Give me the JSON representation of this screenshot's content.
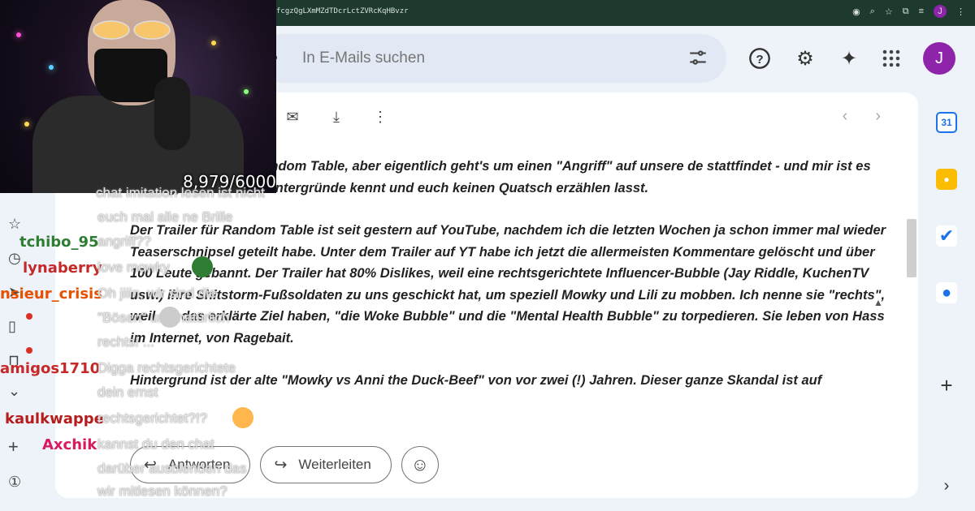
{
  "browser": {
    "url_fragment": "fcgzQgLXmMZdTDcrLctZVRcKqHBvzr",
    "profile_initial": "J"
  },
  "header": {
    "search_placeholder": "In E-Mails suchen",
    "account_initial": "J",
    "accent": "#8e24aa"
  },
  "toolbar": {
    "icons": [
      "mark-unread-icon",
      "move-to-inbox-icon",
      "more-vert-icon"
    ],
    "pager_icons": [
      "chevron-left-icon",
      "chevron-right-icon"
    ]
  },
  "mail": {
    "paragraphs": [
      "g um unseren Film Random Table, aber eigentlich geht's um einen \"Angriff\" auf unsere de stattfindet - und mir ist es wichtig, dass ihr die Hintergründe kennt und euch keinen Quatsch erzählen lasst.",
      "Der Trailer für Random Table ist seit gestern auf YouTube, nachdem ich die letzten Wochen ja schon immer mal wieder Teaserschnipsel geteilt habe. Unter dem Trailer auf YT habe ich jetzt die allermeisten Kommentare gelöscht und über 100 Leute gebannt. Der Trailer hat 80% Dislikes, weil eine rechtsgerichtete Influencer-Bubble (Jay Riddle, KuchenTV usw.) ihre Shitstorm-Fußsoldaten zu uns geschickt hat, um speziell Mowky und Lili zu mobben. Ich nenne sie \"rechts\", weil sie das erklärte Ziel haben, \"die Woke Bubble\" und die \"Mental Health Bubble\" zu torpedieren. Sie leben von Hass im Internet, von Ragebait.",
      "Hintergrund ist der alte \"Mowky vs Anni the Duck-Beef\" von vor zwei (!) Jahren. Dieser ganze Skandal ist auf"
    ],
    "reply_label": "Antworten",
    "forward_label": "Weiterleiten"
  },
  "stream": {
    "sub_goal": "8,979/6000"
  },
  "chat": {
    "users": [
      {
        "name": "tchibo_95",
        "color": "#2e7d32"
      },
      {
        "name": "lynaberry",
        "color": "#c62828"
      },
      {
        "name": "nsieur_crisis",
        "color": "#e65100"
      },
      {
        "name": "amigos1710",
        "color": "#c62828"
      },
      {
        "name": "kaulkwappe",
        "color": "#b71c1c"
      },
      {
        "name": "Axchik",
        "color": "#d81b60"
      }
    ],
    "messages": [
      "chat imitation lesen ist nicht",
      "euch mal alle ne Brille",
      "angriff??",
      "love mowky",
      "Oh jiiin, wir sind die",
      "\"Bösen\" und natürlich",
      "rechts! ...",
      "Digga rechtsgerichtete",
      "dein ernst",
      "rechtsgerichtet?!?",
      "kannst du den chat",
      "darüber ausblenden das",
      "wir mitlesen können?"
    ]
  }
}
